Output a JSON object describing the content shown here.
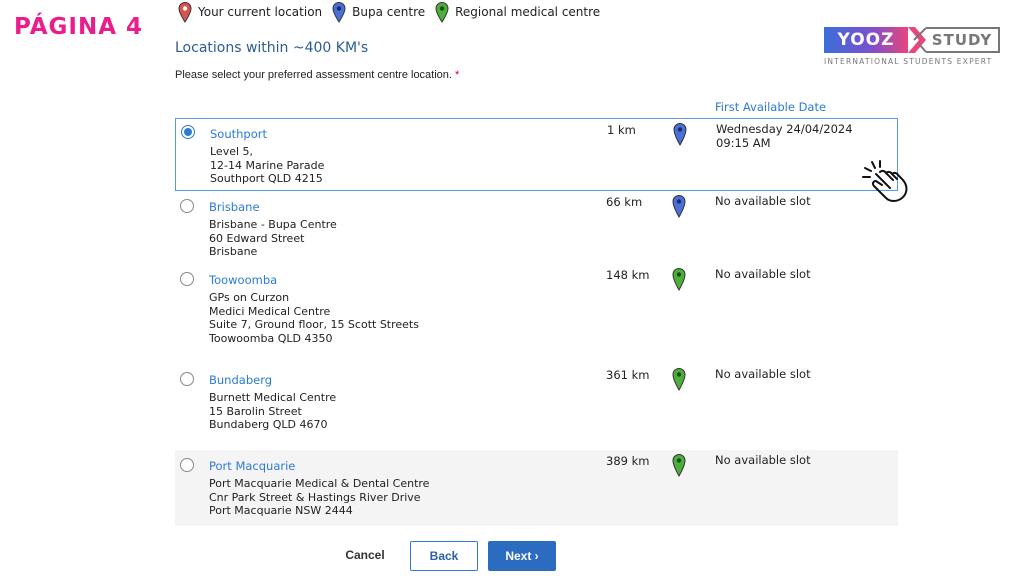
{
  "page_label": "PÁGINA 4",
  "legend": [
    {
      "label": "Your current location",
      "icon": "red-pin-icon",
      "color": "#d9534f"
    },
    {
      "label": "Bupa centre",
      "icon": "blue-pin-icon",
      "color": "#4a6fd8"
    },
    {
      "label": "Regional medical centre",
      "icon": "green-pin-icon",
      "color": "#4caf3c"
    }
  ],
  "logo": {
    "left": "YOOZ",
    "right": "STUDY",
    "tagline": "INTERNATIONAL STUDENTS EXPERT"
  },
  "section_title": "Locations within ~400 KM's",
  "instruction": "Please select your preferred assessment centre location.",
  "required_mark": "*",
  "column_header": "First Available Date",
  "locations": [
    {
      "name": "Southport",
      "address": [
        "Level 5,",
        "12-14 Marine Parade",
        "Southport QLD 4215"
      ],
      "distance": "1 km",
      "type": "bupa",
      "availability": [
        "Wednesday 24/04/2024",
        "09:15 AM"
      ],
      "selected": true
    },
    {
      "name": "Brisbane",
      "address": [
        "Brisbane - Bupa Centre",
        "60 Edward Street",
        "Brisbane"
      ],
      "distance": "66 km",
      "type": "bupa",
      "availability": [
        "No available slot"
      ],
      "selected": false
    },
    {
      "name": "Toowoomba",
      "address": [
        "GPs on Curzon",
        "Medici Medical Centre",
        "Suite 7, Ground floor, 15 Scott Streets",
        "Toowoomba QLD 4350"
      ],
      "distance": "148 km",
      "type": "regional",
      "availability": [
        "No available slot"
      ],
      "selected": false
    },
    {
      "name": "Bundaberg",
      "address": [
        "Burnett Medical Centre",
        "15 Barolin Street",
        "Bundaberg QLD 4670"
      ],
      "distance": "361 km",
      "type": "regional",
      "availability": [
        "No available slot"
      ],
      "selected": false
    },
    {
      "name": "Port Macquarie",
      "address": [
        "Port Macquarie Medical & Dental Centre",
        "Cnr Park Street & Hastings River Drive",
        "Port Macquarie NSW 2444"
      ],
      "distance": "389 km",
      "type": "regional",
      "availability": [
        "No available slot"
      ],
      "selected": false
    }
  ],
  "buttons": {
    "cancel": "Cancel",
    "back": "Back",
    "next": "Next ›"
  },
  "colors": {
    "accent": "#2b7bd6",
    "brand_pink": "#e91e8c",
    "bupa_pin": "#4a6fd8",
    "regional_pin": "#4caf3c",
    "current_pin": "#d9534f"
  }
}
